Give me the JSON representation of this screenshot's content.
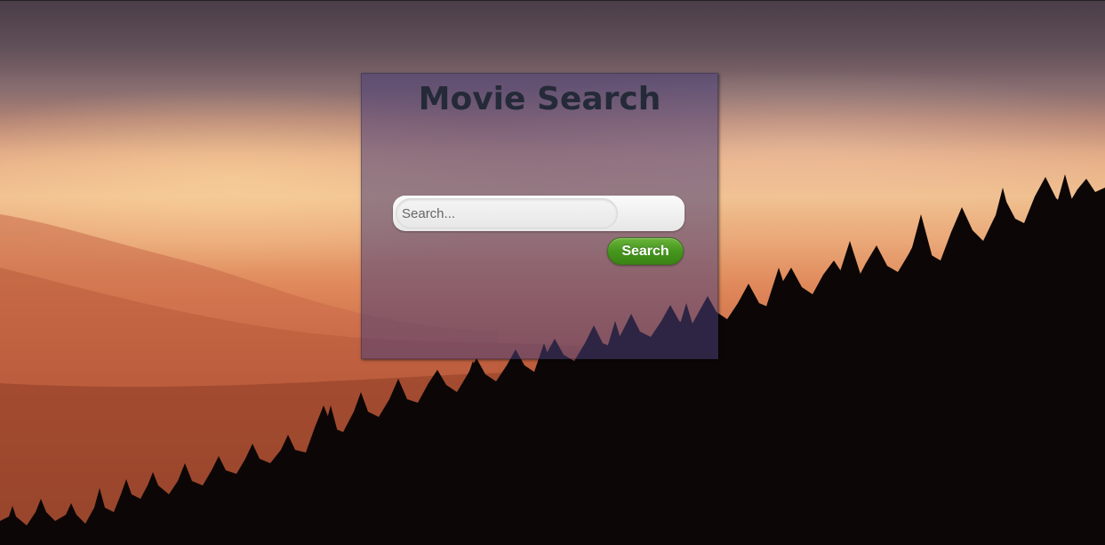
{
  "page": {
    "title": "Movie Search"
  },
  "search": {
    "placeholder": "Search...",
    "value": "",
    "button_label": "Search"
  },
  "colors": {
    "panel": "#483e76",
    "title": "#252a38",
    "button": "#46961e"
  }
}
